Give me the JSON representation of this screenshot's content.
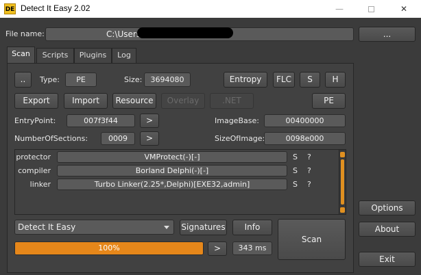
{
  "window": {
    "title": "Detect It Easy 2.02",
    "icon_text": "DE",
    "minimize_glyph": "—",
    "close_glyph": "✕"
  },
  "file": {
    "label": "File name:",
    "value": "C:\\Users\\",
    "browse_label": "..."
  },
  "tabs": [
    "Scan",
    "Scripts",
    "Plugins",
    "Log"
  ],
  "scan": {
    "up_label": "..",
    "type_label": "Type:",
    "type_value": "PE",
    "size_label": "Size:",
    "size_value": "3694080",
    "entropy_label": "Entropy",
    "flc_label": "FLC",
    "s_label": "S",
    "h_label": "H",
    "export_label": "Export",
    "import_label": "Import",
    "resource_label": "Resource",
    "overlay_label": "Overlay",
    "net_label": ".NET",
    "pe_label": "PE",
    "entrypoint_label": "EntryPoint:",
    "entrypoint_value": "007f3f44",
    "entrypoint_go": ">",
    "imagebase_label": "ImageBase:",
    "imagebase_value": "00400000",
    "sections_label": "NumberOfSections:",
    "sections_value": "0009",
    "sections_go": ">",
    "sizeofimage_label": "SizeOfImage:",
    "sizeofimage_value": "0098e000"
  },
  "results": [
    {
      "type": "protector",
      "value": "VMProtect(-)[-]",
      "s": "S",
      "q": "?"
    },
    {
      "type": "compiler",
      "value": "Borland Delphi(-)[-]",
      "s": "S",
      "q": "?"
    },
    {
      "type": "linker",
      "value": "Turbo Linker(2.25*,Delphi)[EXE32,admin]",
      "s": "S",
      "q": "?"
    }
  ],
  "bottom": {
    "engine_value": "Detect It Easy",
    "signatures_label": "Signatures",
    "info_label": "Info",
    "scan_label": "Scan",
    "progress_text": "100%",
    "progress_fraction": 1.0,
    "next_label": ">",
    "time_value": "343 ms"
  },
  "side": {
    "options_label": "Options",
    "about_label": "About",
    "exit_label": "Exit"
  },
  "colors": {
    "accent": "#e6871a",
    "background": "#3b3b3b"
  }
}
